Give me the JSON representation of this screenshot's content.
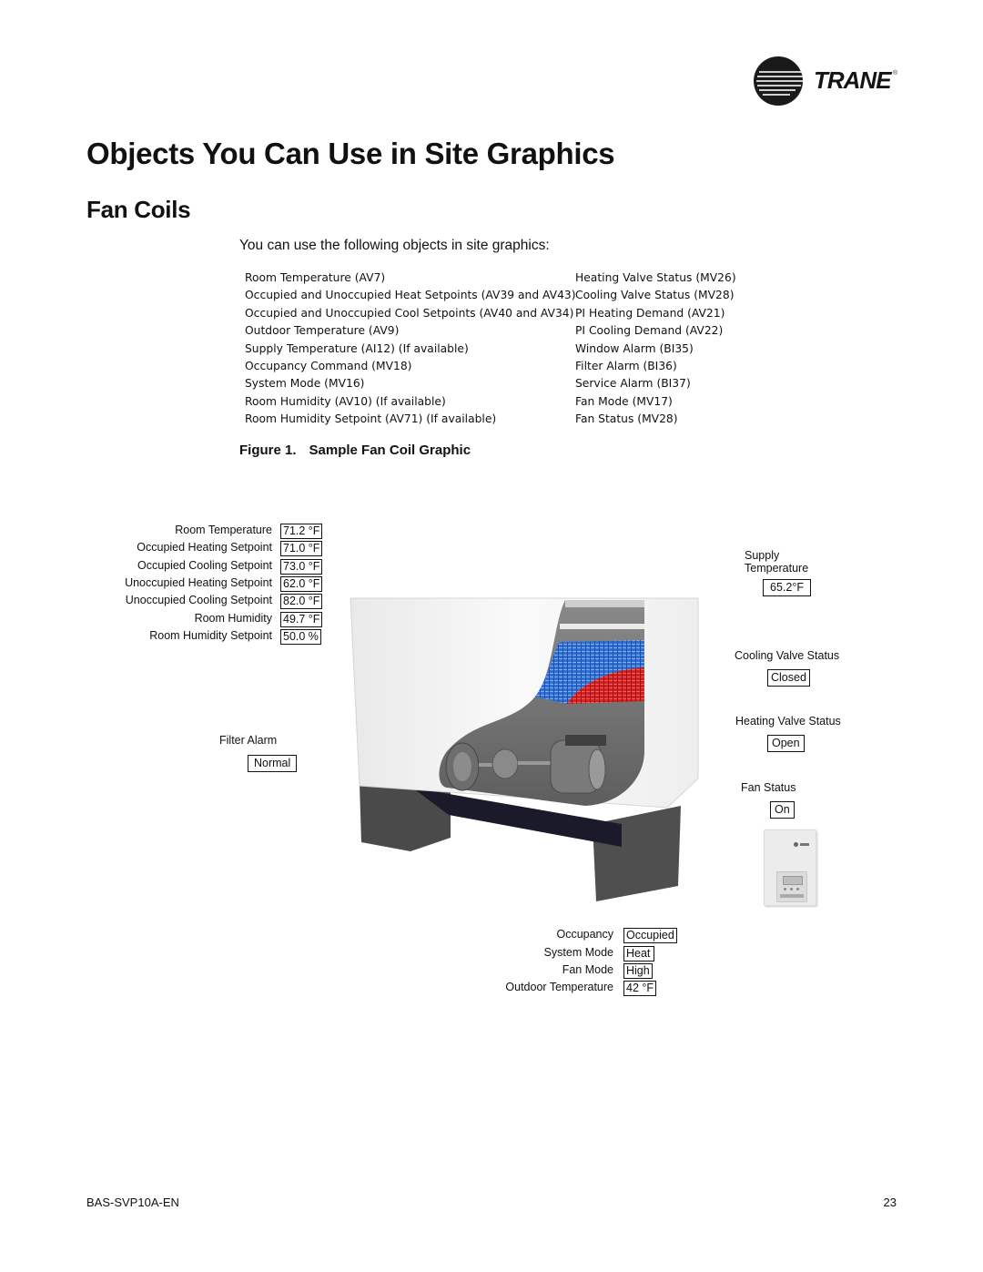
{
  "brand": {
    "logo_text": "TRANE",
    "registered_mark": "®"
  },
  "page_title": "Objects You Can Use in Site Graphics",
  "section_title": "Fan Coils",
  "intro_text": "You can use the following objects in site graphics:",
  "objects_left": [
    "Room Temperature (AV7)",
    "Occupied and Unoccupied Heat Setpoints (AV39 and AV43)",
    "Occupied and Unoccupied Cool Setpoints (AV40 and AV34)",
    "Outdoor Temperature (AV9)",
    "Supply Temperature (AI12) (If available)",
    "Occupancy Command (MV18)",
    "System Mode (MV16)",
    "Room Humidity (AV10) (If available)",
    "Room Humidity Setpoint (AV71) (If available)"
  ],
  "objects_right": [
    "Heating Valve Status (MV26)",
    "Cooling Valve Status (MV28)",
    "PI Heating Demand (AV21)",
    "PI Cooling Demand (AV22)",
    "Window Alarm (BI35)",
    "Filter Alarm (BI36)",
    "Service Alarm (BI37)",
    "Fan Mode (MV17)",
    "Fan Status (MV28)"
  ],
  "figure": {
    "number": "Figure 1.",
    "title": "Sample Fan Coil Graphic",
    "left_points": [
      {
        "label": "Room Temperature",
        "value": "71.2 °F"
      },
      {
        "label": "Occupied Heating Setpoint",
        "value": "71.0 °F"
      },
      {
        "label": "Occupied Cooling Setpoint",
        "value": "73.0 °F"
      },
      {
        "label": "Unoccupied Heating Setpoint",
        "value": "62.0 °F"
      },
      {
        "label": "Unoccupied Cooling Setpoint",
        "value": "82.0 °F"
      },
      {
        "label": "Room Humidity",
        "value": "49.7 °F"
      },
      {
        "label": "Room Humidity Setpoint",
        "value": "50.0 %"
      }
    ],
    "filter_alarm": {
      "label": "Filter Alarm",
      "value": "Normal"
    },
    "supply_temperature": {
      "label_line1": "Supply",
      "label_line2": "Temperature",
      "value": "65.2°F"
    },
    "cooling_valve": {
      "label": "Cooling Valve Status",
      "value": "Closed"
    },
    "heating_valve": {
      "label": "Heating Valve Status",
      "value": "Open"
    },
    "fan_status": {
      "label": "Fan Status",
      "value": "On"
    },
    "bottom_points": [
      {
        "label": "Occupancy",
        "value": "Occupied"
      },
      {
        "label": "System Mode",
        "value": "Heat"
      },
      {
        "label": "Fan Mode",
        "value": "High"
      },
      {
        "label": "Outdoor Temperature",
        "value": "42 °F"
      }
    ],
    "colors": {
      "cooling_coil": "#2f6fd6",
      "heating_coil": "#d42020",
      "cabinet": "#f4f4f4",
      "base": "#4a4a4a"
    }
  },
  "footer": {
    "doc_id": "BAS-SVP10A-EN",
    "page_number": "23"
  }
}
